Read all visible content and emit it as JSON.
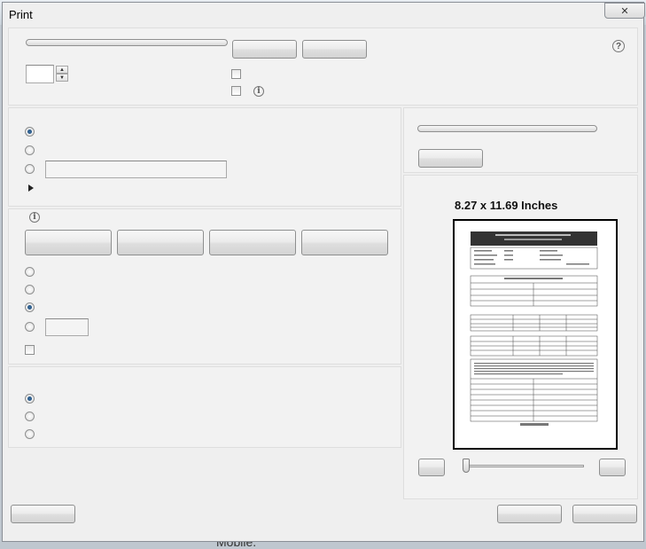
{
  "window": {
    "title": "Print",
    "close_icon": "close-icon",
    "close_glyph": "✕"
  },
  "top_section": {
    "copies_value": "",
    "spinner_up_glyph": "▲",
    "spinner_down_glyph": "▼",
    "help_glyph": "?"
  },
  "orientation_section": {
    "radios": [
      {
        "id": "radio-1",
        "checked": true
      },
      {
        "id": "radio-2",
        "checked": false
      },
      {
        "id": "radio-3",
        "checked": false
      }
    ],
    "custom_field_value": ""
  },
  "sizing_section": {
    "info_glyph": "i",
    "radios": [
      {
        "id": "radio-4",
        "checked": false
      },
      {
        "id": "radio-5",
        "checked": false
      },
      {
        "id": "radio-6",
        "checked": true
      },
      {
        "id": "radio-7",
        "checked": false
      }
    ],
    "custom_scale_value": ""
  },
  "comments_section": {
    "radios": [
      {
        "id": "radio-8",
        "checked": true
      },
      {
        "id": "radio-9",
        "checked": false
      },
      {
        "id": "radio-10",
        "checked": false
      }
    ]
  },
  "preview": {
    "size_label": "8.27 x 11.69 Inches",
    "document_footer": "Please Turn Over"
  },
  "background": {
    "partial_text": "Mobile."
  }
}
